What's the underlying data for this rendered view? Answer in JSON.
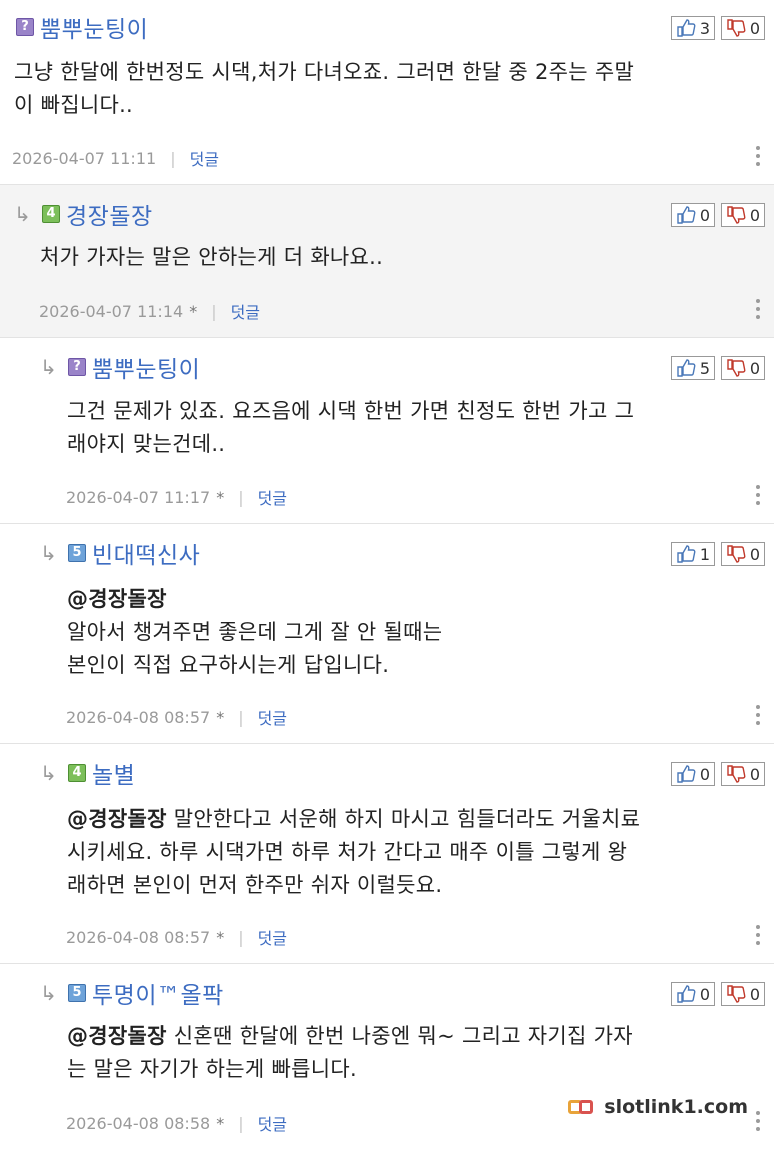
{
  "comments": [
    {
      "level_icon": "?",
      "nickname": "뿜뿌눈팅이",
      "up": "3",
      "down": "0",
      "lines": [
        "그냥 한달에 한번정도 시댁,처가 다녀오죠. 그러면 한달 중 2주는 주말",
        "이 빠집니다.."
      ],
      "mention": "",
      "date": "2026-04-07 11:11",
      "edited": "",
      "reply_label": "덧글"
    },
    {
      "level_icon": "4",
      "nickname": "경장돌장",
      "up": "0",
      "down": "0",
      "lines": [
        "처가 가자는 말은 안하는게 더 화나요.."
      ],
      "mention": "",
      "date": "2026-04-07 11:14",
      "edited": "*",
      "reply_label": "덧글"
    },
    {
      "level_icon": "?",
      "nickname": "뿜뿌눈팅이",
      "up": "5",
      "down": "0",
      "lines": [
        "그건 문제가 있죠. 요즈음에 시댁 한번 가면 친정도 한번 가고 그",
        "래야지 맞는건데.."
      ],
      "mention": "",
      "date": "2026-04-07 11:17",
      "edited": "*",
      "reply_label": "덧글"
    },
    {
      "level_icon": "5",
      "nickname": "빈대떡신사",
      "up": "1",
      "down": "0",
      "mention": "@경장돌장",
      "lines": [
        "알아서 챙겨주면 좋은데 그게 잘 안 될때는",
        "본인이 직접 요구하시는게 답입니다."
      ],
      "date": "2026-04-08 08:57",
      "edited": "*",
      "reply_label": "덧글"
    },
    {
      "level_icon": "4",
      "nickname": "놀별",
      "up": "0",
      "down": "0",
      "mention": "@경장돌장",
      "first_line_rest": " 말안한다고 서운해 하지 마시고 힘들더라도 거울치료",
      "lines": [
        "시키세요. 하루 시댁가면 하루 처가 간다고 매주 이틀 그렇게 왕",
        "래하면 본인이 먼저 한주만 쉬자 이럴듯요."
      ],
      "date": "2026-04-08 08:57",
      "edited": "*",
      "reply_label": "덧글"
    },
    {
      "level_icon": "5",
      "nickname": "투명이™올팍",
      "up": "0",
      "down": "0",
      "mention": "@경장돌장",
      "first_line_rest": " 신혼땐 한달에 한번 나중엔 뭐~ 그리고 자기집 가자",
      "lines": [
        "는 말은 자기가 하는게 빠릅니다."
      ],
      "date": "2026-04-08 08:58",
      "edited": "*",
      "reply_label": "덧글"
    }
  ],
  "watermark": "slotlink1.com",
  "colors": {
    "nickname": "#3d6cc1",
    "reply_bg": "#f4f4f4",
    "meta_text": "#9a9a9a",
    "level_question": "#9a84c9",
    "level_green": "#7cbf5a",
    "level_blue": "#6fa3d9"
  },
  "icons": {
    "vote_up": "thumbs-up-icon",
    "vote_down": "thumbs-down-icon",
    "reply_arrow": "reply-arrow-icon",
    "more": "more-vertical-icon"
  }
}
